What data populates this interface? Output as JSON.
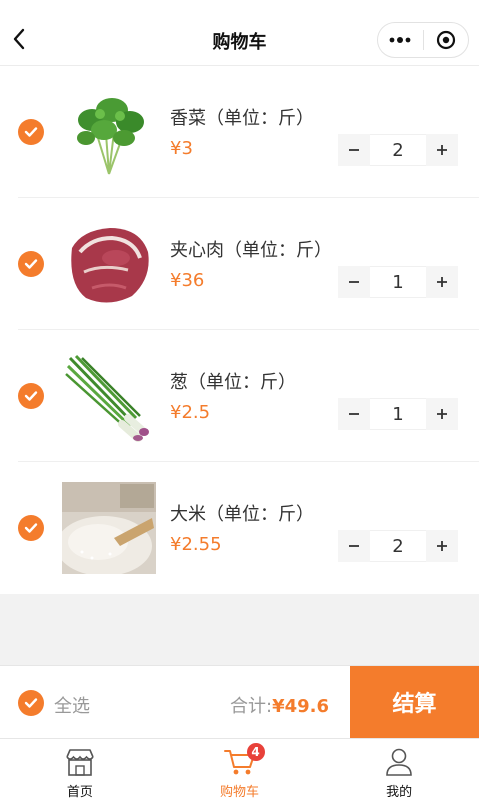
{
  "navbar": {
    "title": "购物车"
  },
  "cart": {
    "items": [
      {
        "name": "香菜（单位：斤）",
        "price": "¥3",
        "quantity": "2",
        "checked": true,
        "image": "cilantro"
      },
      {
        "name": "夹心肉（单位：斤）",
        "price": "¥36",
        "quantity": "1",
        "checked": true,
        "image": "pork"
      },
      {
        "name": "葱（单位：斤）",
        "price": "¥2.5",
        "quantity": "1",
        "checked": true,
        "image": "scallion"
      },
      {
        "name": "大米（单位：斤）",
        "price": "¥2.55",
        "quantity": "2",
        "checked": true,
        "image": "rice"
      }
    ]
  },
  "footer": {
    "select_all_label": "全选",
    "total_label": "合计:",
    "total_amount": "¥49.6",
    "checkout_label": "结算"
  },
  "tabbar": {
    "tabs": [
      {
        "label": "首页",
        "icon": "store-icon",
        "active": false
      },
      {
        "label": "购物车",
        "icon": "cart-icon",
        "active": true,
        "badge": "4"
      },
      {
        "label": "我的",
        "icon": "user-icon",
        "active": false
      }
    ]
  },
  "colors": {
    "accent": "#f47c2c",
    "badge": "#e8413a"
  }
}
